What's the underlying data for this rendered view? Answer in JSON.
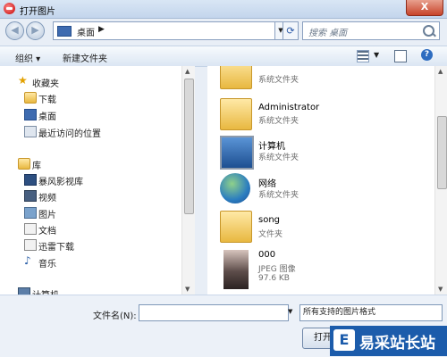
{
  "window": {
    "title": "打开图片",
    "close": "X"
  },
  "navigation": {
    "breadcrumb": "桌面",
    "breadcrumb_arrow": "▶",
    "search_placeholder": "搜索 桌面"
  },
  "toolbar": {
    "organize": "组织 ▾",
    "new_folder": "新建文件夹",
    "help": "?"
  },
  "sidebar": {
    "favorites": {
      "label": "收藏夹",
      "items": [
        "下载",
        "桌面",
        "最近访问的位置"
      ]
    },
    "libraries": {
      "label": "库",
      "items": [
        "暴风影视库",
        "视频",
        "图片",
        "文档",
        "迅雷下载",
        "音乐"
      ]
    },
    "computer": "计算机"
  },
  "files": [
    {
      "name": "",
      "type": "系统文件夹",
      "icon": "folder-icon"
    },
    {
      "name": "Administrator",
      "type": "系统文件夹",
      "icon": "user-folder-icon"
    },
    {
      "name": "计算机",
      "type": "系统文件夹",
      "icon": "computer-icon"
    },
    {
      "name": "网络",
      "type": "系统文件夹",
      "icon": "network-icon"
    },
    {
      "name": "song",
      "type": "文件夹",
      "icon": "folder-icon"
    },
    {
      "name": "000",
      "type": "JPEG 图像",
      "size": "97.6 KB",
      "icon": "image-thumbnail"
    }
  ],
  "footer": {
    "filename_label": "文件名(N):",
    "filename_value": "",
    "filetype": "所有支持的图片格式",
    "open_button": "打开"
  },
  "watermark": {
    "logo": "E",
    "text": "易采站长站"
  }
}
